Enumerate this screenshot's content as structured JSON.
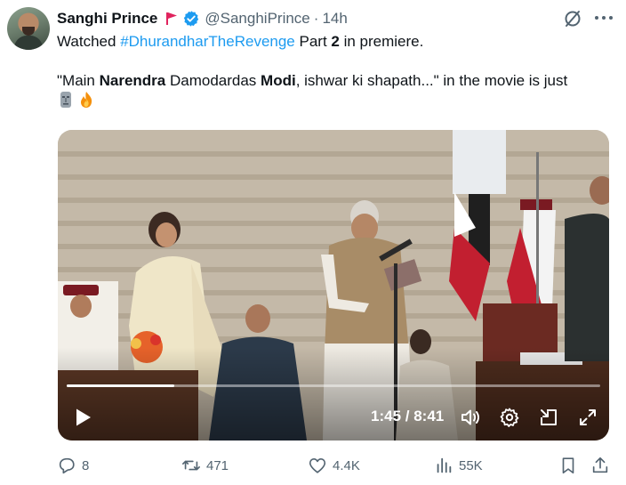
{
  "author": {
    "display_name": "Sanghi Prince",
    "handle": "@SanghiPrince",
    "separator": "·",
    "time": "14h",
    "flag_color": "#e0245e",
    "verified_color": "#1d9bf0"
  },
  "tweet": {
    "line1_prefix": "Watched ",
    "hashtag": "#DhurandharTheRevenge",
    "line1_mid": " Part ",
    "line1_bold": "2",
    "line1_suffix": " in premiere.",
    "quote_1": "\"Main ",
    "quote_bold_1": "Narendra",
    "quote_2": " Damodardas ",
    "quote_bold_2": "Modi",
    "quote_3": ", ishwar ki shapath...\" in the movie is just",
    "emojis": [
      "moai-icon",
      "fire-icon"
    ]
  },
  "video": {
    "current_time": "1:45",
    "time_separator": " / ",
    "duration": "8:41",
    "progress": 0.2015
  },
  "actions": {
    "replies": "8",
    "reposts": "471",
    "likes": "4.4K",
    "views": "55K"
  },
  "icons": [
    "grok-icon",
    "more-icon",
    "play-icon",
    "volume-icon",
    "settings-icon",
    "pip-icon",
    "fullscreen-icon",
    "reply-icon",
    "repost-icon",
    "like-icon",
    "views-icon",
    "bookmark-icon",
    "share-icon"
  ],
  "colors": {
    "text": "#0f1419",
    "muted": "#536471",
    "link": "#1d9bf0"
  }
}
